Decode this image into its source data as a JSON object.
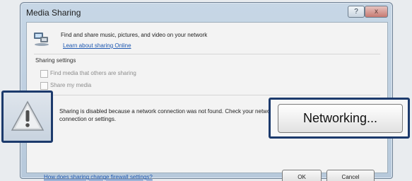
{
  "window": {
    "title": "Media Sharing",
    "help_label": "?",
    "close_label": "x"
  },
  "header": {
    "description": "Find and share music, pictures, and video on your network",
    "learn_more": "Learn about sharing Online"
  },
  "sharing": {
    "group_label": "Sharing settings",
    "find_media": "Find media that others are sharing",
    "share_my_media": "Share my media"
  },
  "warning": {
    "text": "Sharing is disabled because a network connection was not found. Check your network connection or settings."
  },
  "buttons": {
    "networking": "Networking...",
    "ok": "OK",
    "cancel": "Cancel"
  },
  "footer": {
    "firewall_link": "How does sharing change firewall settings?"
  },
  "colors": {
    "highlight_border": "#1c3a6c",
    "link": "#1b56b0"
  }
}
